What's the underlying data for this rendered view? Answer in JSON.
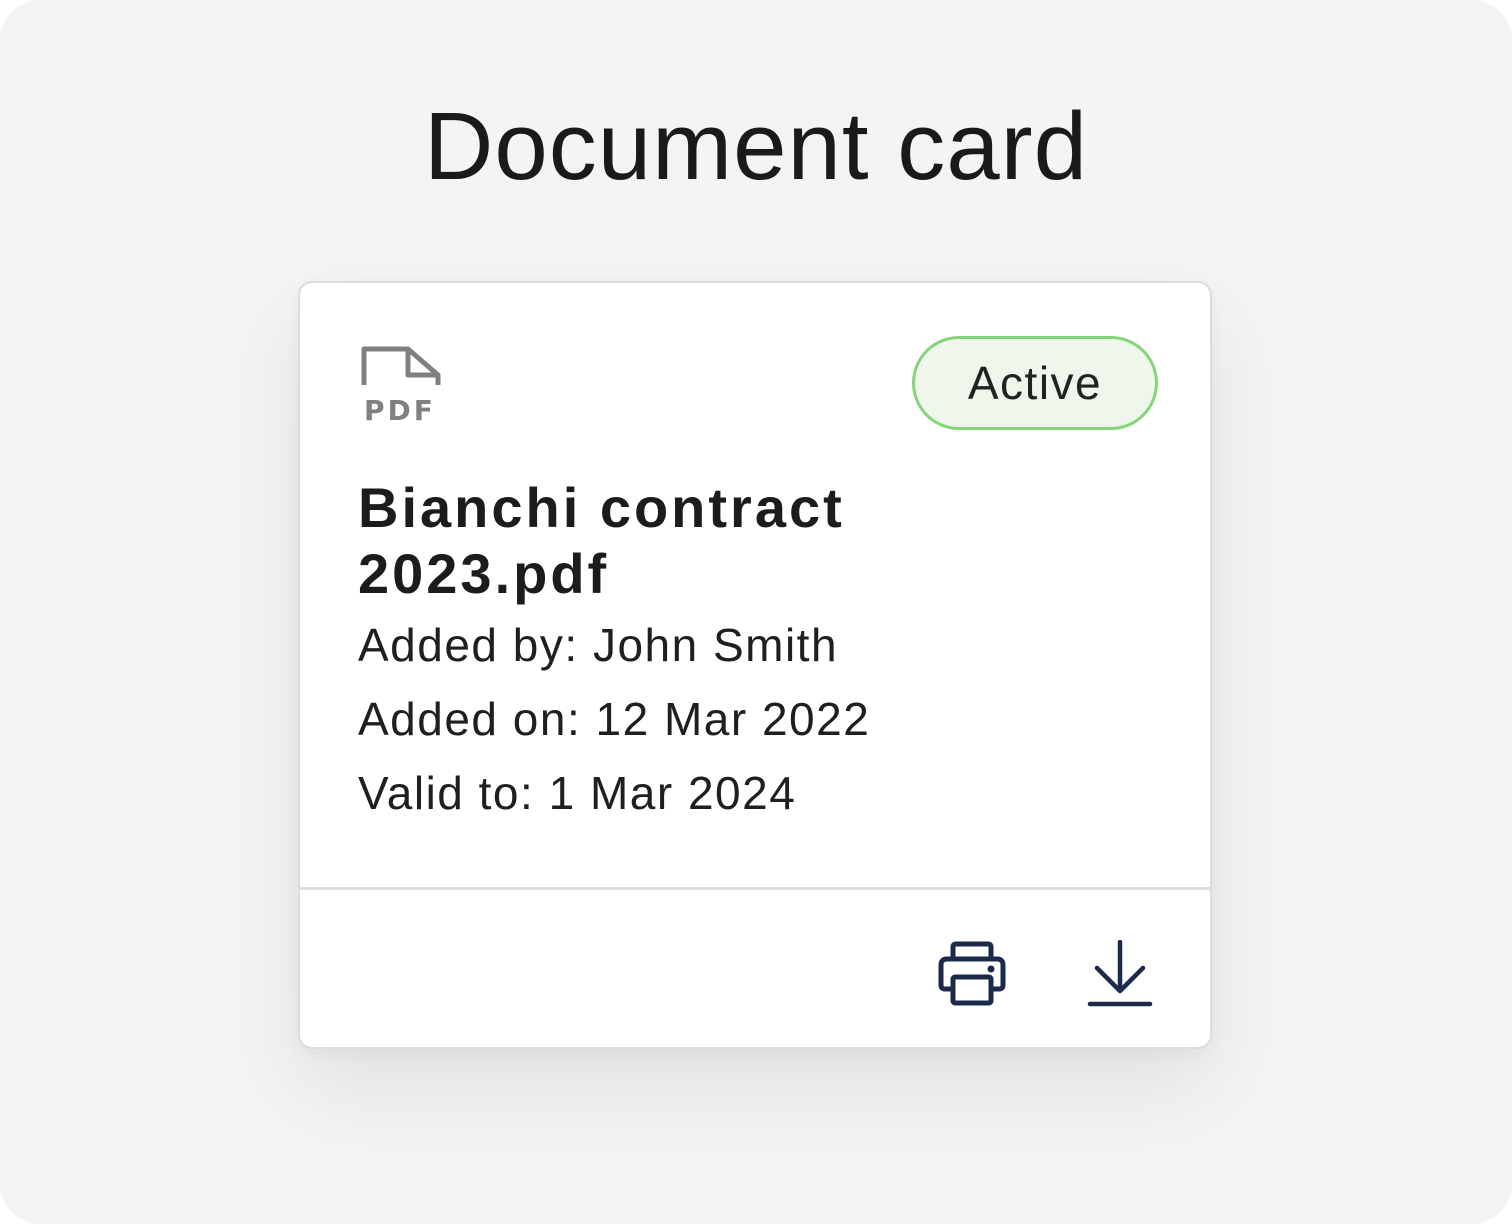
{
  "page": {
    "title": "Document card"
  },
  "card": {
    "file_type_label": "PDF",
    "status": "Active",
    "document_name": "Bianchi contract 2023.pdf",
    "added_by": "Added by: John Smith",
    "added_on": "Added on: 12 Mar 2022",
    "valid_to": "Valid to: 1 Mar 2024"
  },
  "actions": {
    "print_icon": "printer-icon",
    "download_icon": "download-icon"
  },
  "colors": {
    "background": "#f4f4f4",
    "card_background": "#ffffff",
    "status_border": "#86d47a",
    "status_fill": "#eff7ec",
    "icon_primary": "#1b2a4a",
    "file_icon": "#808080"
  }
}
